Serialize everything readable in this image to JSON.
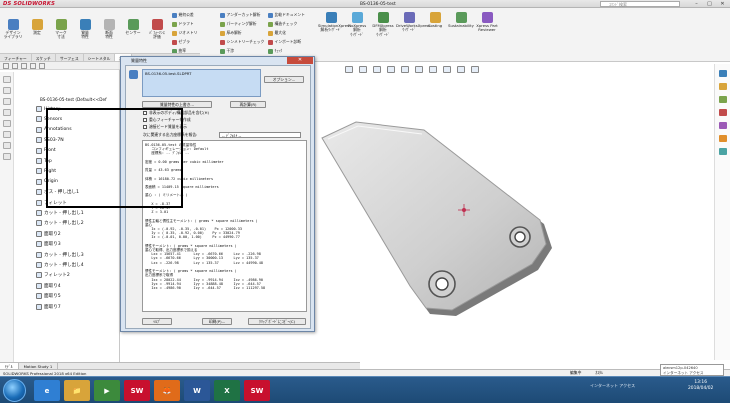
{
  "app": {
    "logo": "DS SOLIDWORKS",
    "file_title": "BS-0136-05-test",
    "search_placeholder": "ｺﾏﾝﾄﾞ検索"
  },
  "ribbon": {
    "big_buttons": [
      {
        "label": "デザイン\nライブラリ",
        "color": "#4a7fc1"
      },
      {
        "label": "測定",
        "color": "#d8a43a"
      },
      {
        "label": "マーク\n寸法",
        "color": "#7aa34b"
      },
      {
        "label": "質量\n特性",
        "color": "#3a7fb8"
      },
      {
        "label": "断面\n特性",
        "color": "#b4b4b4"
      },
      {
        "label": "センサー",
        "color": "#5a9a5a"
      },
      {
        "label": "ﾊﾟﾌｫｰﾏﾝｽ\n評価",
        "color": "#c14b4b"
      }
    ],
    "small_buttons": [
      "幾何公差",
      "ドラフト",
      "ジオメトリ",
      "ゼブラ",
      "曲率",
      "アンダーカット解析",
      "パーティング解析",
      "厚み解析",
      "シンメトリーチェック",
      "干渉",
      "比較ドキュメント",
      "構造チェック",
      "最大化",
      "インポート診断",
      "ﾁｪｯｸ"
    ],
    "addins": [
      "SimulationXpress\n解析ｳｨｻﾞｰﾄﾞ",
      "FloXpress\n解析\nｳｨｻﾞｰﾄﾞ",
      "DFMXpress\n解析\nｳｨｻﾞｰﾄﾞ",
      "DriveWorksXpress\nｳｨｻﾞｰﾄﾞ",
      "Costing",
      "Sustainability",
      "Xpress Part\nReviewer"
    ],
    "tabs": [
      "フィーチャー",
      "スケッチ",
      "サーフェス",
      "シートメタル",
      "評価"
    ]
  },
  "tree": {
    "root": "BS-0136-05-test (Default<<Def",
    "items": [
      "History",
      "Sensors",
      "Annotations",
      "SS03-7N",
      "Front",
      "Top",
      "Right",
      "Origin",
      "ボス - 押し出し1",
      "フィレット",
      "カット - 押し出し1",
      "カット - 押し出し2",
      "面取り2",
      "面取り3",
      "カット - 押し出し3",
      "カット - 押し出し4",
      "フィレット2",
      "面取り4",
      "面取り5",
      "面取り7"
    ]
  },
  "bottom_tabs": [
    "ﾓﾃﾞﾙ",
    "Motion Study 1"
  ],
  "status": {
    "left": "SOLIDWORKS Professional 2018 x64 Edition",
    "right": [
      "編集中",
      "ｶｽﾀﾑ"
    ]
  },
  "dialog": {
    "title": "質量特性",
    "selection": "BS-0136-05-test.SLDPRT",
    "options_button": "オプション...",
    "override_button": "質量特性の上書き...",
    "recalc_button": "再計算(R)",
    "checks": [
      "非表示のボディ/構成部品を含む(H)",
      "重心フィーチャーを作成",
      "溶接ビード質量を表示"
    ],
    "coord_label": "次に関連する出力座標系を報告:",
    "coord_value": "-- ﾃﾞﾌｫﾙﾄ --",
    "report_lines": [
      "BS-0136-05-test の質量特性",
      "   コンフィギュレーション: Default",
      "   座標系: -- ﾃﾞﾌｫﾙﾄ --",
      "",
      "密度 = 0.00 grams per cubic millimeter",
      "",
      "質量 = 43.63 grams",
      "",
      "体積 = 16180.72 cubic millimeters",
      "",
      "表面積 = 11409.15 square millimeters",
      "",
      "重心 : ( ミリメートル )",
      "",
      "   X = -8.37",
      "   Y = 18.47",
      "   Z = 3.01",
      "",
      "慣性主軸と慣性主モーメント: ( grams * square millimeters )",
      "重心",
      "   Ix = (-0.92, -0.35, -0.01)    Px = 12000.33",
      "   Iy = ( 0.35, -0.92, 0.00)    Py = 33024.79",
      "   Iz = (-0.01, 0.00, 1.00)     Pz = 44990.77",
      "",
      "慣性モーメント: ( grams * square millimeters )",
      "重心で取得、出力座標系で揃える",
      "   Lxx = 15657.41      Lxy = -6670.66     Lxz = -226.98",
      "   Lyx = -6670.66      Lyy = 30000.13     Lyz = 135.37",
      "   Lzx = -226.98       Lzy = 135.37       Lzz = 44990.48",
      "",
      "慣性モーメント: ( grams * square millimeters )",
      "出力座標系で取得",
      "   Ixx = 28022.44      Ixy = -9914.94     Ixz = -4986.90",
      "   Iyx = -9914.94      Iyy = 34888.48     Iyz = -644.57",
      "   Izx = -4986.90      Izy = -644.57      Izz = 111297.58"
    ],
    "help_button": "ﾍﾙﾌﾟ",
    "print_button": "印刷(P)...",
    "copy_button": "ｸﾘｯﾌﾟﾎﾞｰﾄﾞにｺﾋﾟｰ(C)"
  },
  "taskbar": {
    "apps": [
      {
        "label": "e",
        "color": "#2f7fd3"
      },
      {
        "label": "📁",
        "color": "#d8a43a"
      },
      {
        "label": "▶",
        "color": "#3c8a3c"
      },
      {
        "label": "SW",
        "color": "#c8102e"
      },
      {
        "label": "🦊",
        "color": "#e06b1a"
      },
      {
        "label": "W",
        "color": "#2b5797"
      },
      {
        "label": "X",
        "color": "#1f7244"
      },
      {
        "label": "SW",
        "color": "#c8102e"
      }
    ],
    "tray_text": "インターネット アクセス",
    "time": "13:16",
    "date": "2018/04/02",
    "notif_line1": "alecsm12p-042640",
    "notif_line2": "インターネット アクセス"
  },
  "colors": {
    "accent": "#c8102e",
    "dialog_bg": "#d9e4f1",
    "selection_bg": "#c6dcf3",
    "taskbar": "#1d4a75"
  }
}
